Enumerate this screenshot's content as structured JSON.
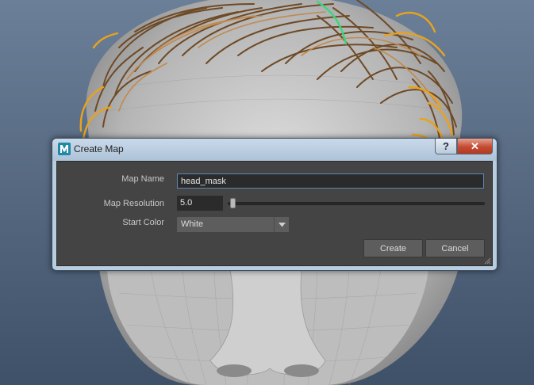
{
  "dialog": {
    "title": "Create Map",
    "icon": "maya-m-icon",
    "help_label": "?",
    "close_label": "✕"
  },
  "form": {
    "map_name_label": "Map Name",
    "map_name_value": "head_mask",
    "map_resolution_label": "Map Resolution",
    "map_resolution_value": "5.0",
    "resolution_slider_fraction": 0.01,
    "start_color_label": "Start Color",
    "start_color_value": "White"
  },
  "buttons": {
    "create": "Create",
    "cancel": "Cancel"
  },
  "colors": {
    "accent": "#5d87b3",
    "panel": "#444444",
    "titlebar": "#b9cde0",
    "close": "#c44a31"
  }
}
